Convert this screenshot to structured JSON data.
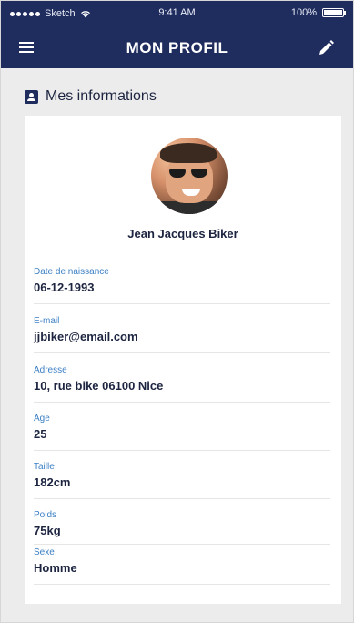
{
  "status_bar": {
    "carrier": "Sketch",
    "time": "9:41 AM",
    "battery": "100%"
  },
  "nav": {
    "title": "MON PROFIL"
  },
  "section": {
    "title": "Mes informations"
  },
  "profile": {
    "name": "Jean Jacques Biker",
    "fields": [
      {
        "label": "Date de naissance",
        "value": "06-12-1993"
      },
      {
        "label": "E-mail",
        "value": "jjbiker@email.com"
      },
      {
        "label": "Adresse",
        "value": "10, rue bike 06100 Nice"
      },
      {
        "label": "Age",
        "value": "25"
      },
      {
        "label": "Taille",
        "value": "182cm"
      },
      {
        "label": "Poids",
        "value": "75kg"
      },
      {
        "label": "Sexe",
        "value": "Homme"
      }
    ]
  },
  "colors": {
    "header": "#1f2c5e",
    "label": "#3b7fc4",
    "background": "#ececec"
  },
  "icons": {
    "menu": "hamburger-menu-icon",
    "edit": "pencil-icon",
    "section": "user-card-icon",
    "wifi": "wifi-icon",
    "battery": "battery-icon"
  }
}
